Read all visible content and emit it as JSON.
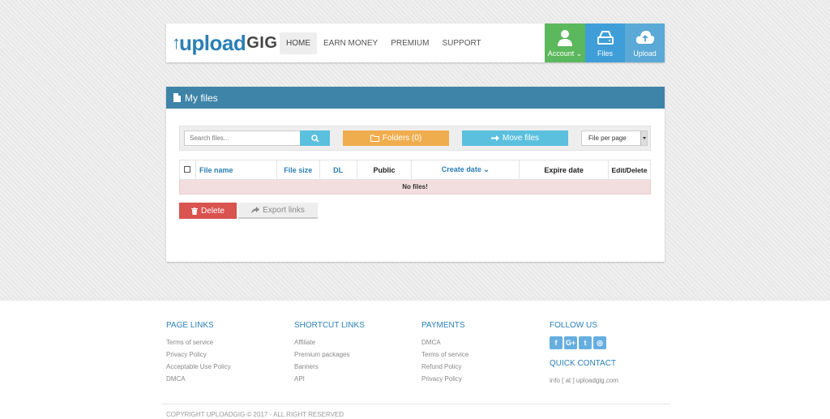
{
  "brand": {
    "logo_up": "upload",
    "logo_gig": "GIG"
  },
  "nav": [
    {
      "label": "HOME"
    },
    {
      "label": "EARN MONEY"
    },
    {
      "label": "PREMIUM"
    },
    {
      "label": "SUPPORT"
    }
  ],
  "tiles": {
    "account": "Account",
    "files": "Files",
    "upload": "Upload"
  },
  "panel": {
    "title": "My files"
  },
  "toolbar": {
    "search_placeholder": "Search files...",
    "folders": "Folders (0)",
    "move": "Move files",
    "per_page": "File per page"
  },
  "table": {
    "headers": [
      "File name",
      "File size",
      "DL",
      "Public",
      "Create date",
      "Expire date",
      "Edit/Delete"
    ],
    "empty": "No files!"
  },
  "actions": {
    "delete": "Delete",
    "export": "Export links"
  },
  "footer": {
    "page_links": {
      "title": "PAGE LINKS",
      "items": [
        "Terms of service",
        "Privacy Policy",
        "Acceptable Use Policy",
        "DMCA"
      ]
    },
    "shortcut_links": {
      "title": "SHORTCUT LINKS",
      "items": [
        "Affiliate",
        "Premium packages",
        "Banners",
        "API"
      ]
    },
    "payments": {
      "title": "PAYMENTS",
      "items": [
        "DMCA",
        "Terms of service",
        "Refund Policy",
        "Privacy Policy"
      ]
    },
    "follow": {
      "title": "FOLLOW US"
    },
    "quick": {
      "title": "QUICK CONTACT",
      "email": "info [ at ] uploadgig.com"
    },
    "copyright": "COPYRIGHT UPLOADGIG © 2017 - ALL RIGHT RESERVED"
  },
  "colors": {
    "accent": "#3e84a8",
    "account": "#5cb85c",
    "files": "#3f9ed8",
    "folders": "#f0ad4e",
    "delete": "#d9534f"
  }
}
